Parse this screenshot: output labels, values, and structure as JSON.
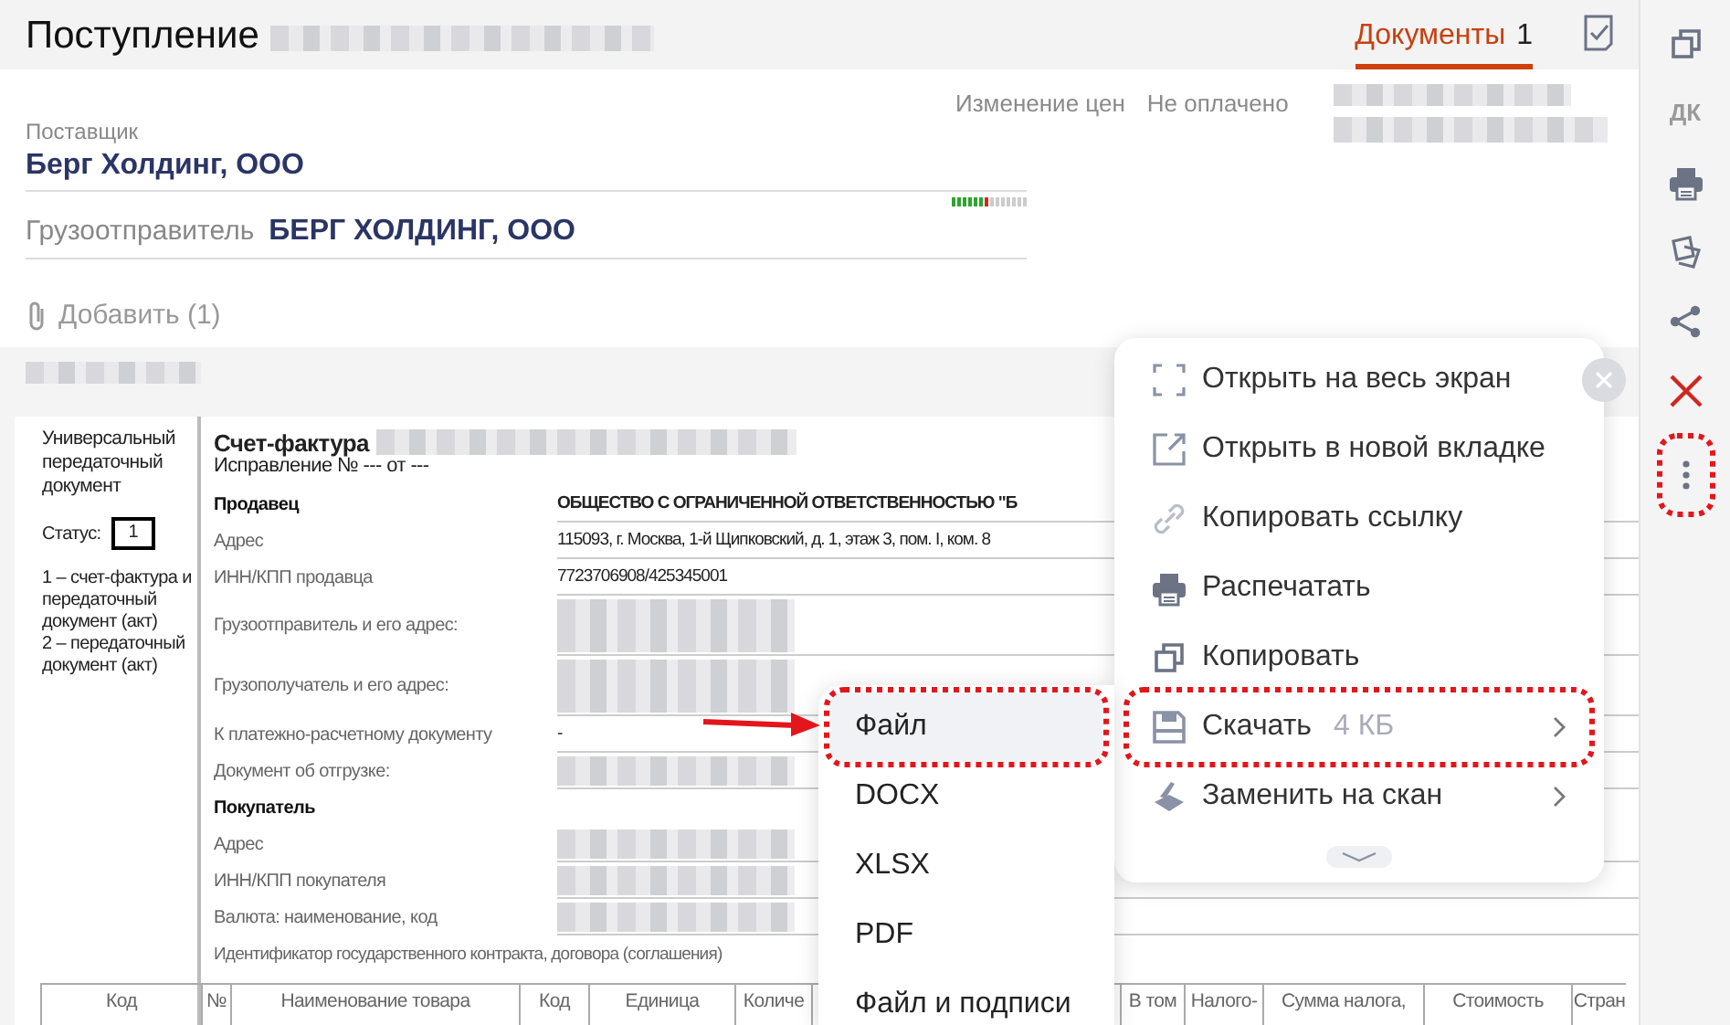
{
  "header": {
    "title": "Поступление",
    "tab": {
      "label": "Документы",
      "count": "1",
      "selected": true
    }
  },
  "status_tags": [
    "Изменение цен",
    "Не оплачено"
  ],
  "supplier": {
    "label": "Поставщик",
    "value": "Берг Холдинг, ООО"
  },
  "shipper": {
    "label": "Грузоотправитель",
    "value": "БЕРГ ХОЛДИНГ, ООО",
    "level": 0.5
  },
  "attach": {
    "label": "Добавить (1)"
  },
  "toolbar": [
    {
      "kind": "copy",
      "highlighted": false
    },
    {
      "kind": "text",
      "label": "ДК",
      "highlighted": false
    },
    {
      "kind": "print",
      "highlighted": false
    },
    {
      "kind": "pages",
      "highlighted": false
    },
    {
      "kind": "share",
      "highlighted": false
    },
    {
      "kind": "delete",
      "highlighted": false
    },
    {
      "kind": "more",
      "highlighted": true
    }
  ],
  "document": {
    "side": {
      "title": "Универсальный передаточный документ",
      "status_label": "Статус:",
      "status_value": "1",
      "legend": [
        "1 – счет-фактура и передаточный документ (акт)",
        "2 – передаточный документ (акт)"
      ]
    },
    "title": "Счет-фактура",
    "correction": "Исправление № --- от ---",
    "rows": [
      {
        "kind": "heading",
        "label": "Продавец",
        "value": "ОБЩЕСТВО С ОГРАНИЧЕННОЙ ОТВЕТСТВЕННОСТЬЮ \"Б"
      },
      {
        "kind": "field",
        "label": "Адрес",
        "value": "115093, г. Москва, 1-й Щипковский, д. 1, этаж 3, пом. I, ком. 8"
      },
      {
        "kind": "field",
        "label": "ИНН/КПП продавца",
        "value": "7723706908/425345001"
      },
      {
        "kind": "tall",
        "label": "Грузоотправитель и его адрес:"
      },
      {
        "kind": "tall",
        "label": "Грузополучатель и его адрес:"
      },
      {
        "kind": "field",
        "label": "К платежно-расчетному документу",
        "value": "-"
      },
      {
        "kind": "field",
        "label": "Документ об отгрузке:"
      },
      {
        "kind": "heading",
        "label": "Покупатель"
      },
      {
        "kind": "field",
        "label": "Адрес"
      },
      {
        "kind": "field",
        "label": "ИНН/КПП покупателя"
      },
      {
        "kind": "field",
        "label": "Валюта: наименование, код"
      },
      {
        "kind": "wide",
        "label": "Идентификатор государственного контракта, договора (соглашения)"
      }
    ],
    "columns": [
      "Код",
      "№",
      "Наименование товара",
      "Код",
      "Единица",
      "Количе",
      "В том",
      "Налого-",
      "Сумма налога,",
      "Стоимость",
      "Стран"
    ]
  },
  "menu": {
    "items": [
      {
        "kind": "fullscreen",
        "label": "Открыть на весь экран",
        "highlighted": false,
        "submenu": false
      },
      {
        "kind": "newtab",
        "label": "Открыть в новой вкладке",
        "highlighted": false,
        "submenu": false
      },
      {
        "kind": "link",
        "label": "Копировать ссылку",
        "highlighted": false,
        "submenu": false
      },
      {
        "kind": "print",
        "label": "Распечатать",
        "highlighted": false,
        "submenu": false
      },
      {
        "kind": "copy",
        "label": "Копировать",
        "highlighted": false,
        "submenu": false
      },
      {
        "kind": "save",
        "label": "Скачать",
        "hint": "4 КБ",
        "highlighted": true,
        "submenu": true
      },
      {
        "kind": "scan",
        "label": "Заменить на скан",
        "highlighted": false,
        "submenu": true
      }
    ]
  },
  "submenu": [
    {
      "label": "Файл",
      "highlighted": true
    },
    {
      "label": "DOCX",
      "highlighted": false
    },
    {
      "label": "XLSX",
      "highlighted": false
    },
    {
      "label": "PDF",
      "highlighted": false
    },
    {
      "label": "Файл и подписи",
      "highlighted": false
    }
  ]
}
